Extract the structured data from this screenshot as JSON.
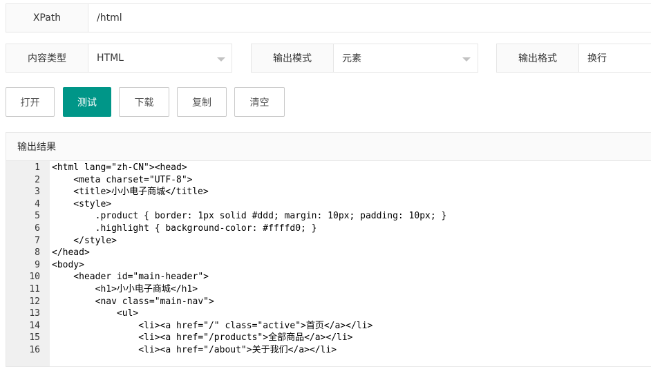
{
  "xpath": {
    "label": "XPath",
    "value": "/html"
  },
  "content_type": {
    "label": "内容类型",
    "value": "HTML"
  },
  "output_mode": {
    "label": "输出模式",
    "value": "元素"
  },
  "output_format": {
    "label": "输出格式",
    "value": "换行"
  },
  "buttons": {
    "open": "打开",
    "test": "测试",
    "download": "下载",
    "copy": "复制",
    "clear": "清空"
  },
  "result": {
    "title": "输出结果",
    "lines": [
      {
        "n": "1",
        "code": "<html lang=\"zh-CN\"><head>"
      },
      {
        "n": "2",
        "code": "    <meta charset=\"UTF-8\">"
      },
      {
        "n": "3",
        "code": "    <title>小小电子商城</title>"
      },
      {
        "n": "4",
        "code": "    <style>"
      },
      {
        "n": "5",
        "code": "        .product { border: 1px solid #ddd; margin: 10px; padding: 10px; }"
      },
      {
        "n": "6",
        "code": "        .highlight { background-color: #ffffd0; }"
      },
      {
        "n": "7",
        "code": "    </style>"
      },
      {
        "n": "8",
        "code": "</head>"
      },
      {
        "n": "9",
        "code": "<body>"
      },
      {
        "n": "10",
        "code": "    <header id=\"main-header\">"
      },
      {
        "n": "11",
        "code": "        <h1>小小电子商城</h1>"
      },
      {
        "n": "12",
        "code": "        <nav class=\"main-nav\">"
      },
      {
        "n": "13",
        "code": "            <ul>"
      },
      {
        "n": "14",
        "code": "                <li><a href=\"/\" class=\"active\">首页</a></li>"
      },
      {
        "n": "15",
        "code": "                <li><a href=\"/products\">全部商品</a></li>"
      },
      {
        "n": "16",
        "code": "                <li><a href=\"/about\">关于我们</a></li>"
      }
    ]
  },
  "colors": {
    "primary": "#009688",
    "border": "#e6e6e6",
    "label_bg": "#fafafa",
    "gutter_bg": "#f0f0f0"
  }
}
